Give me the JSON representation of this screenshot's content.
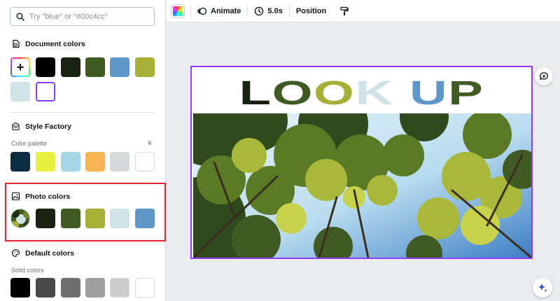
{
  "search": {
    "placeholder": "Try \"blue\" or \"#00c4cc\""
  },
  "document_colors": {
    "title": "Document colors",
    "swatches": [
      "#010101",
      "#1a2212",
      "#3f5a22",
      "#5f97c8",
      "#a4b136",
      "#cfe2e6"
    ],
    "selected_swatch": "#ffffff"
  },
  "style_factory": {
    "title": "Style Factory",
    "sub_label": "Color palette",
    "swatches": [
      "#0d2d45",
      "#e8f03e",
      "#a7d5e6",
      "#f8b355",
      "#d7d8d9",
      "#ffffff"
    ]
  },
  "photo_colors": {
    "title": "Photo colors",
    "swatches": [
      "#1a2212",
      "#3f5a22",
      "#a4b136",
      "#cfe2e6",
      "#5f97c8"
    ]
  },
  "default_colors": {
    "title": "Default colors",
    "sub_label": "Solid colors",
    "swatches": [
      "#000000",
      "#4a4a4a",
      "#707070",
      "#9e9e9e",
      "#cccccc",
      "#ffffff"
    ]
  },
  "toolbar": {
    "animate_label": "Animate",
    "duration_label": "5.0s",
    "position_label": "Position"
  },
  "canvas": {
    "headline_letters": [
      {
        "char": "L",
        "color": "#1a2212"
      },
      {
        "char": "O",
        "color": "#3f5a22"
      },
      {
        "char": "O",
        "color": "#a4b136"
      },
      {
        "char": "K",
        "color": "#cfe2e6"
      },
      {
        "char": " ",
        "color": "#ffffff"
      },
      {
        "char": "U",
        "color": "#5f97c8"
      },
      {
        "char": "P",
        "color": "#3f5a22"
      }
    ]
  },
  "accent_color": "#8b3dff",
  "highlight_color": "#e0262c"
}
